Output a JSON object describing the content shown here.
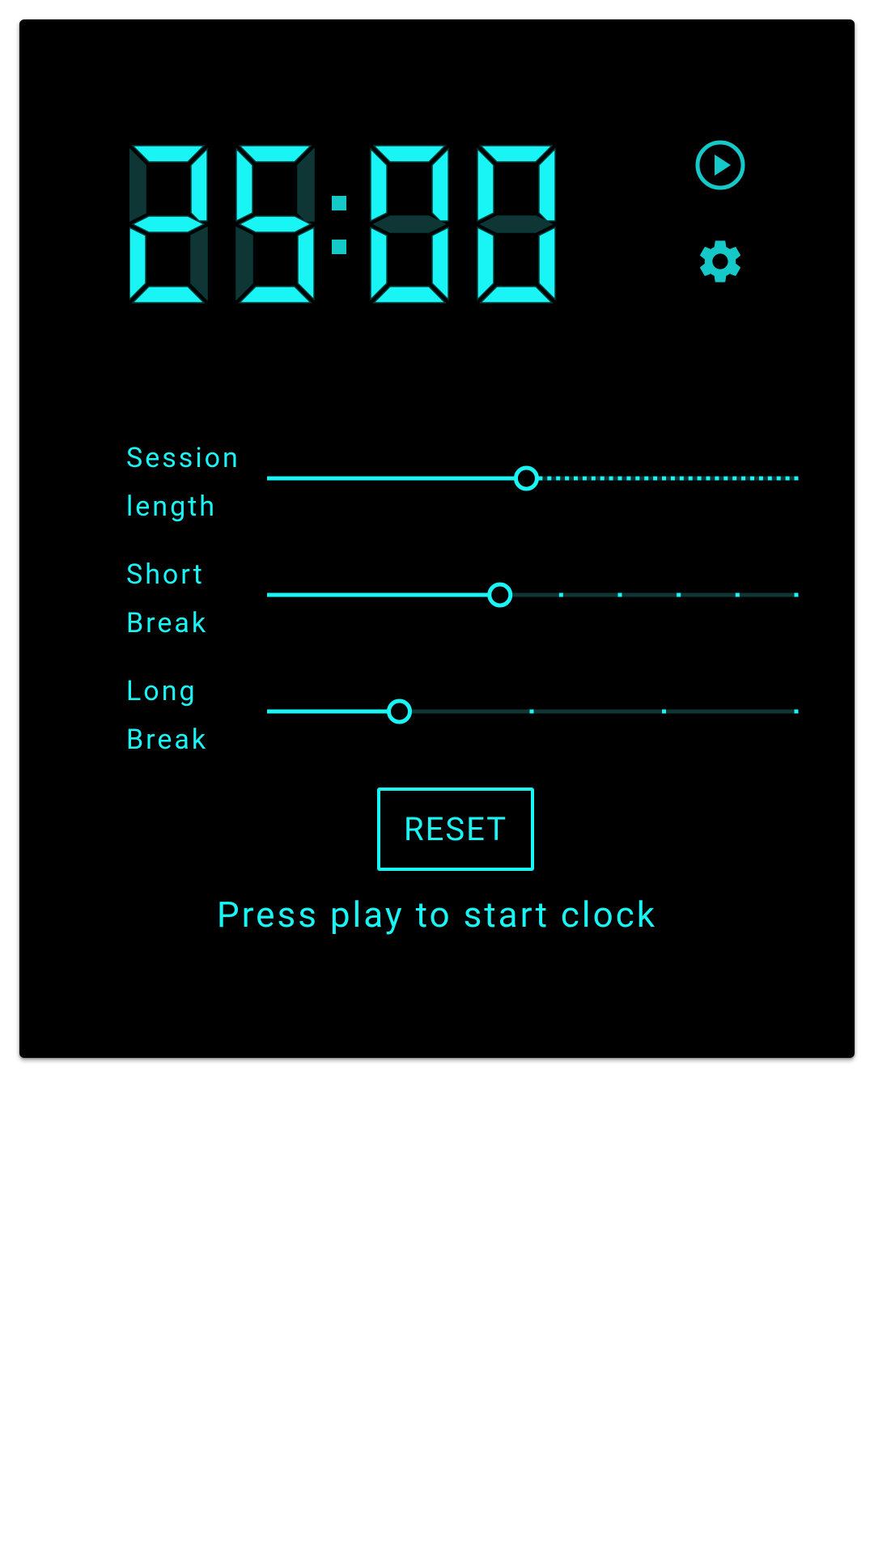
{
  "timer": {
    "display": "25:00",
    "digits": [
      "2",
      "5",
      "0",
      "0"
    ]
  },
  "controls": {
    "play_icon": "play-circle-icon",
    "settings_icon": "gear-icon"
  },
  "sliders": [
    {
      "id": "session",
      "label_line1": "Session",
      "label_line2": "length",
      "fraction": 0.49,
      "steps": 60
    },
    {
      "id": "short-break",
      "label_line1": "Short",
      "label_line2": "Break",
      "fraction": 0.44,
      "steps": 9
    },
    {
      "id": "long-break",
      "label_line1": "Long",
      "label_line2": "Break",
      "fraction": 0.25,
      "steps": 4
    }
  ],
  "reset_label": "RESET",
  "status_text": "Press play to start clock",
  "colors": {
    "accent": "#19f5f5",
    "accent_dim": "#0f3535",
    "icon": "#16c9c9",
    "background": "#000000"
  }
}
